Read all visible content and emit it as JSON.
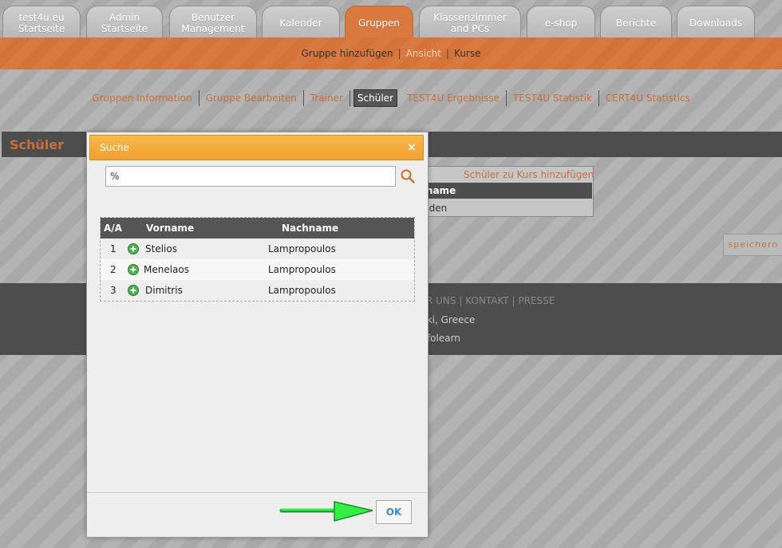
{
  "tabs": [
    {
      "label": "test4u.eu\nStartseite",
      "active": false
    },
    {
      "label": "Admin\nStartseite",
      "active": false
    },
    {
      "label": "Benutzer\nManagement",
      "active": false
    },
    {
      "label": "Kalender",
      "active": false
    },
    {
      "label": "Gruppen",
      "active": true
    },
    {
      "label": "Klassenzimmer\nand PCs",
      "active": false
    },
    {
      "label": "e-shop",
      "active": false
    },
    {
      "label": "Berichte",
      "active": false
    },
    {
      "label": "Downloads",
      "active": false
    }
  ],
  "subnav": {
    "add": "Gruppe hinzufügen",
    "view": "Ansicht",
    "courses": "Kurse",
    "sep": "|"
  },
  "group_tabs": [
    {
      "label": "Gruppen Information",
      "active": false
    },
    {
      "label": "Gruppe Bearbeiten",
      "active": false
    },
    {
      "label": "Trainer",
      "active": false
    },
    {
      "label": "Schüler",
      "active": true
    },
    {
      "label": "TEST4U Ergebnisse",
      "active": false
    },
    {
      "label": "TEST4U Statistik",
      "active": false
    },
    {
      "label": "CERT4U Statistics",
      "active": false
    }
  ],
  "section_title": "Schüler",
  "course_panel": {
    "add_link": "Schüler zu Kurs hinzufügen",
    "header": "rname",
    "row": "nden"
  },
  "save_label": "speichern",
  "footer": {
    "links": "R UNS | KONTAKT | PRESSE",
    "city": "aiki, Greece",
    "brand": "infolearn"
  },
  "dialog": {
    "title": "Suche",
    "close": "×",
    "search_value": "%",
    "columns": {
      "aa": "A/A",
      "first": "Vorname",
      "last": "Nachname"
    },
    "rows": [
      {
        "num": "1",
        "first": "Stelios",
        "last": "Lampropoulos"
      },
      {
        "num": "2",
        "first": "Menelaos",
        "last": "Lampropoulos"
      },
      {
        "num": "3",
        "first": "Dimitris",
        "last": "Lampropoulos"
      }
    ],
    "ok_label": "OK"
  },
  "colors": {
    "accent": "#d9783f",
    "link": "#c8703a",
    "dialog_title": "#f0a030",
    "ok_text": "#3a8ad0",
    "add_icon": "#4caf50",
    "arrow": "#22dd33"
  }
}
